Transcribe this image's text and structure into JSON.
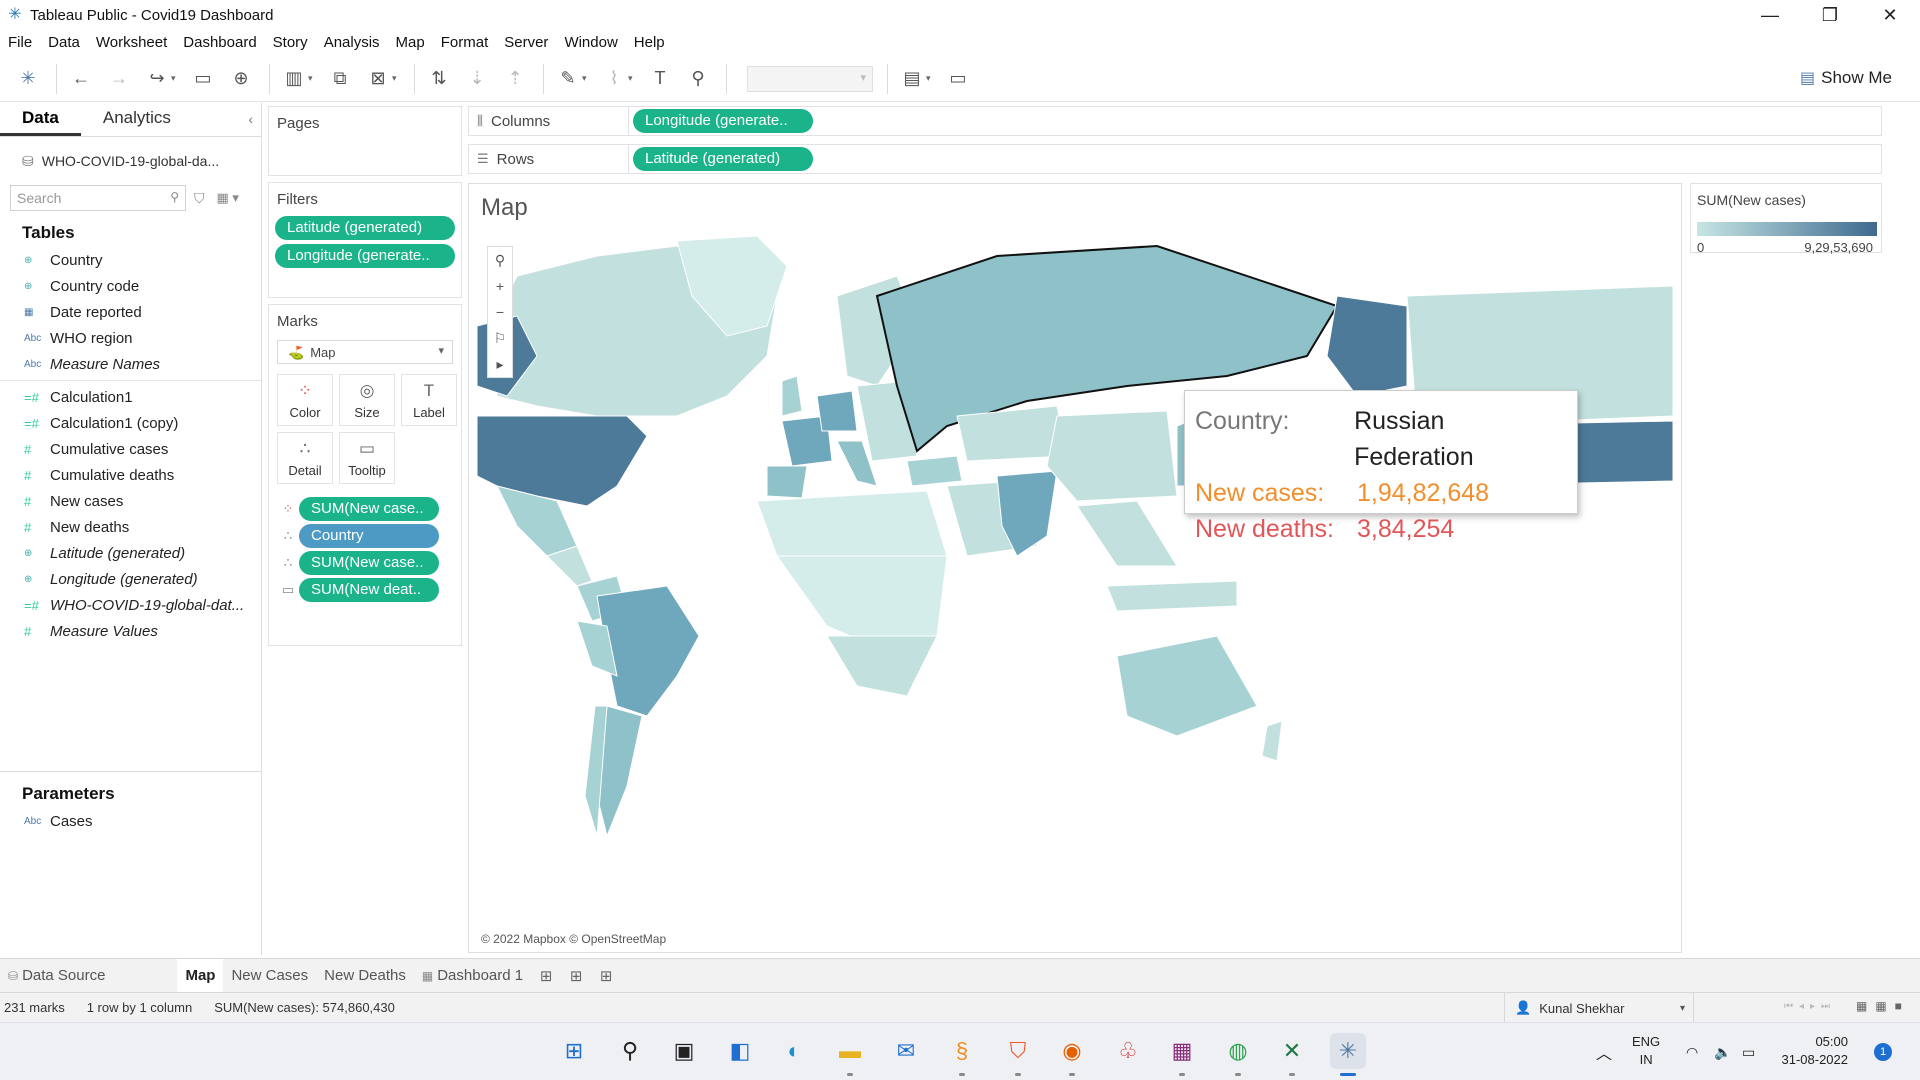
{
  "window": {
    "title": "Tableau Public - Covid19 Dashboard",
    "controls": [
      "—",
      "❐",
      "✕"
    ]
  },
  "menu": [
    "File",
    "Data",
    "Worksheet",
    "Dashboard",
    "Story",
    "Analysis",
    "Map",
    "Format",
    "Server",
    "Window",
    "Help"
  ],
  "toolbar": {
    "show_me_label": "Show Me"
  },
  "data_pane": {
    "tabs": [
      "Data",
      "Analytics"
    ],
    "datasource": "WHO-COVID-19-global-da...",
    "search_placeholder": "Search",
    "tables_header": "Tables",
    "fields": [
      {
        "type": "geo",
        "label": "Country"
      },
      {
        "type": "geo",
        "label": "Country code"
      },
      {
        "type": "date",
        "label": "Date reported"
      },
      {
        "type": "abc",
        "label": "WHO region"
      },
      {
        "type": "abc",
        "label": "Measure Names"
      },
      {
        "type": "meas",
        "label": "Calculation1"
      },
      {
        "type": "meas",
        "label": "Calculation1 (copy)"
      },
      {
        "type": "meas",
        "label": "Cumulative cases"
      },
      {
        "type": "meas",
        "label": "Cumulative deaths"
      },
      {
        "type": "meas",
        "label": "New cases"
      },
      {
        "type": "meas",
        "label": "New deaths"
      },
      {
        "type": "geo",
        "label": "Latitude (generated)"
      },
      {
        "type": "geo",
        "label": "Longitude (generated)"
      },
      {
        "type": "meas",
        "label": "WHO-COVID-19-global-dat..."
      },
      {
        "type": "meas",
        "label": "Measure Values"
      }
    ],
    "parameters_header": "Parameters",
    "parameters": [
      {
        "type": "abc",
        "label": "Cases"
      }
    ]
  },
  "pages": {
    "header": "Pages"
  },
  "filters": {
    "header": "Filters",
    "pills": [
      "Latitude (generated)",
      "Longitude (generate.."
    ]
  },
  "marks": {
    "header": "Marks",
    "type": "Map",
    "buttons": [
      "Color",
      "Size",
      "Label",
      "Detail",
      "Tooltip"
    ],
    "pills": [
      "SUM(New case..",
      "Country",
      "SUM(New case..",
      "SUM(New deat.."
    ]
  },
  "shelves": {
    "columns_label": "Columns",
    "columns_pill": "Longitude (generate..",
    "rows_label": "Rows",
    "rows_pill": "Latitude (generated)"
  },
  "view": {
    "title": "Map",
    "attribution": "© 2022 Mapbox © OpenStreetMap"
  },
  "tooltip": {
    "country_label": "Country:",
    "country_value": "Russian Federation",
    "cases_label": "New cases:",
    "cases_value": "1,94,82,648",
    "deaths_label": "New deaths:",
    "deaths_value": "3,84,254"
  },
  "legend": {
    "title": "SUM(New cases)",
    "min": "0",
    "max": "9,29,53,690",
    "color_low": "#c6e6e4",
    "color_high": "#3e6a8f"
  },
  "sheet_tabs": {
    "data_source": "Data Source",
    "sheets": [
      "Map",
      "New Cases",
      "New Deaths",
      "Dashboard 1"
    ],
    "active": "Map"
  },
  "status": {
    "marks": "231 marks",
    "rows_cols": "1 row by 1 column",
    "sum": "SUM(New cases): 574,860,430",
    "user": "Kunal Shekhar"
  },
  "taskbar": {
    "lang_top": "ENG",
    "lang_bottom": "IN",
    "time": "05:00",
    "date": "31-08-2022",
    "notifications": "1"
  },
  "colors": {
    "pill_green": "#1bb38a",
    "pill_blue": "#4d9ac4",
    "high_country": "#4e7a9a",
    "mid_country": "#8fc1c9",
    "low_country": "#c2e1de"
  }
}
